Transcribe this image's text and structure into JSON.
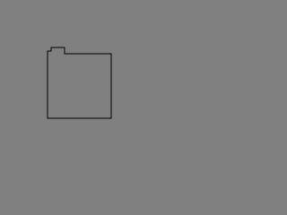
{
  "screen": {
    "background_color": "#808080"
  },
  "folder": {
    "icon": "folder-outline-icon",
    "stroke_color": "#000000"
  }
}
